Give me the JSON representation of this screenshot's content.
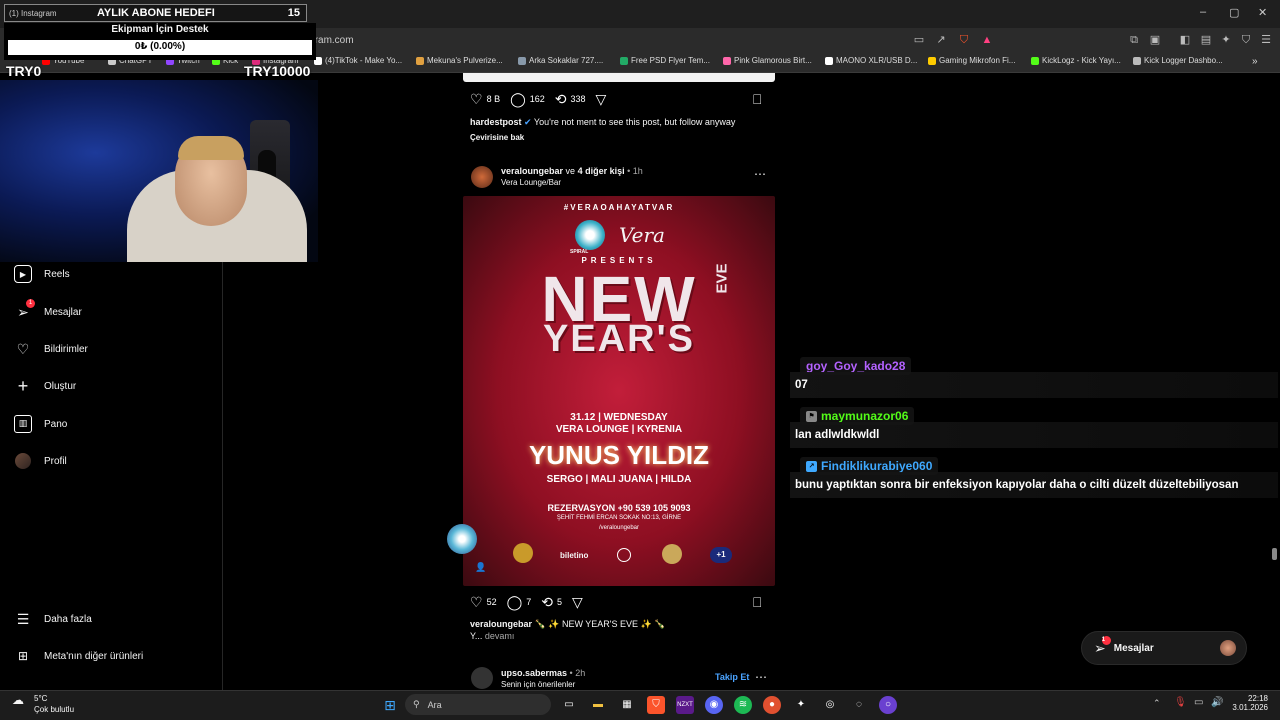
{
  "browser": {
    "tab_title": "(1) Instagram",
    "url": "instagram.com",
    "bookmarks": [
      {
        "label": "YouTube",
        "color": "#ff0000"
      },
      {
        "label": "ChatGPT",
        "color": "#cccccc"
      },
      {
        "label": "Twitch",
        "color": "#9146ff"
      },
      {
        "label": "Kick",
        "color": "#53fc18"
      },
      {
        "label": "Instagram",
        "color": "#dd2a7b"
      },
      {
        "label": "(4)TikTok - Make Yo...",
        "color": "#ffffff"
      },
      {
        "label": "Mekuna's Pulverize...",
        "color": "#e0a040"
      },
      {
        "label": "Arka Sokaklar 727....",
        "color": "#8899aa"
      },
      {
        "label": "Free PSD Flyer Tem...",
        "color": "#22aa66"
      },
      {
        "label": "Pink Glamorous Birt...",
        "color": "#ff66aa"
      },
      {
        "label": "MAONO XLR/USB D...",
        "color": "#ffffff"
      },
      {
        "label": "Gaming Mikrofon Fi...",
        "color": "#ffcc00"
      },
      {
        "label": "KickLogz - Kick Yayı...",
        "color": "#53fc18"
      },
      {
        "label": "Kick Logger Dashbo...",
        "color": "#bbbbbb"
      }
    ]
  },
  "overlay": {
    "goal_label": "AYLIK ABONE HEDEFI",
    "goal_count": "15",
    "support_title": "Ekipman İçin Destek",
    "support_progress": "0₺ (0.00%)",
    "support_fraction": 0,
    "try_min": "TRY0",
    "try_max": "TRY10000"
  },
  "sidebar": {
    "items": [
      {
        "label": "Reels",
        "icon": "reels-icon",
        "glyph": "▶"
      },
      {
        "label": "Mesajlar",
        "icon": "messages-icon",
        "glyph": "➢",
        "badge": "1"
      },
      {
        "label": "Bildirimler",
        "icon": "heart-icon",
        "glyph": "♡"
      },
      {
        "label": "Oluştur",
        "icon": "plus-icon",
        "glyph": "+"
      },
      {
        "label": "Pano",
        "icon": "dashboard-icon",
        "glyph": "▥"
      },
      {
        "label": "Profil",
        "icon": "avatar"
      }
    ],
    "more_label": "Daha fazla",
    "meta_label": "Meta'nın diğer ürünleri"
  },
  "post1": {
    "likes": "8 B",
    "comments": "162",
    "reposts": "338",
    "username": "hardestpost",
    "caption": "You're not ment to see this post, but follow anyway",
    "translate": "Çevirisine bak"
  },
  "post2": {
    "username": "veraloungebar",
    "with": "ve",
    "others": "4 diğer kişi",
    "time": "• 1h",
    "subtitle": "Vera Lounge/Bar",
    "poster": {
      "hashtag": "#VERAOAHAYATVAR",
      "brand1": "SPIRAL",
      "brand2": "Vera",
      "presents": "PRESENTS",
      "line1": "NEW",
      "eve": "EVE",
      "line2": "YEAR'S",
      "date": "31.12 | WEDNESDAY",
      "venue": "VERA LOUNGE | KYRENIA",
      "headliner": "YUNUS YILDIZ",
      "support": "SERGO | MALI JUANA | HILDA",
      "reservation": "REZERVASYON +90 539 105 9093",
      "address": "ŞEHİT FEHMİ ERCAN SOKAK NO:13, GİRNE",
      "handle": "/veraloungebar",
      "biletino": "biletino",
      "plus": "+1"
    },
    "likes": "52",
    "comments": "7",
    "reposts": "5",
    "caption_user": "veraloungebar",
    "caption": "🍾 ✨ NEW YEAR'S EVE ✨ 🍾",
    "caption_more": "Y...",
    "more": "devamı"
  },
  "post3": {
    "username": "upso.sabermas",
    "time": "• 2h",
    "subtitle": "Senin için önerilenler",
    "follow": "Takip Et"
  },
  "chat": [
    {
      "name": "goy_Goy_kado28",
      "color": "#b462ff",
      "message": "07"
    },
    {
      "name": "maymunazor06",
      "color": "#53fc18",
      "message": "lan adlwldkwldl"
    },
    {
      "name": "Findiklikurabiye060",
      "color": "#3fa9ff",
      "message": "bunu yaptıktan sonra bir enfeksiyon kapıyolar daha o cilti düzelt düzeltebiliyosan"
    }
  ],
  "messages_pill": {
    "label": "Mesajlar",
    "badge": "1"
  },
  "taskbar": {
    "weather_temp": "5°C",
    "weather_desc": "Çok bulutlu",
    "search_placeholder": "Ara",
    "time": "22:18",
    "date": "3.01.2026"
  }
}
